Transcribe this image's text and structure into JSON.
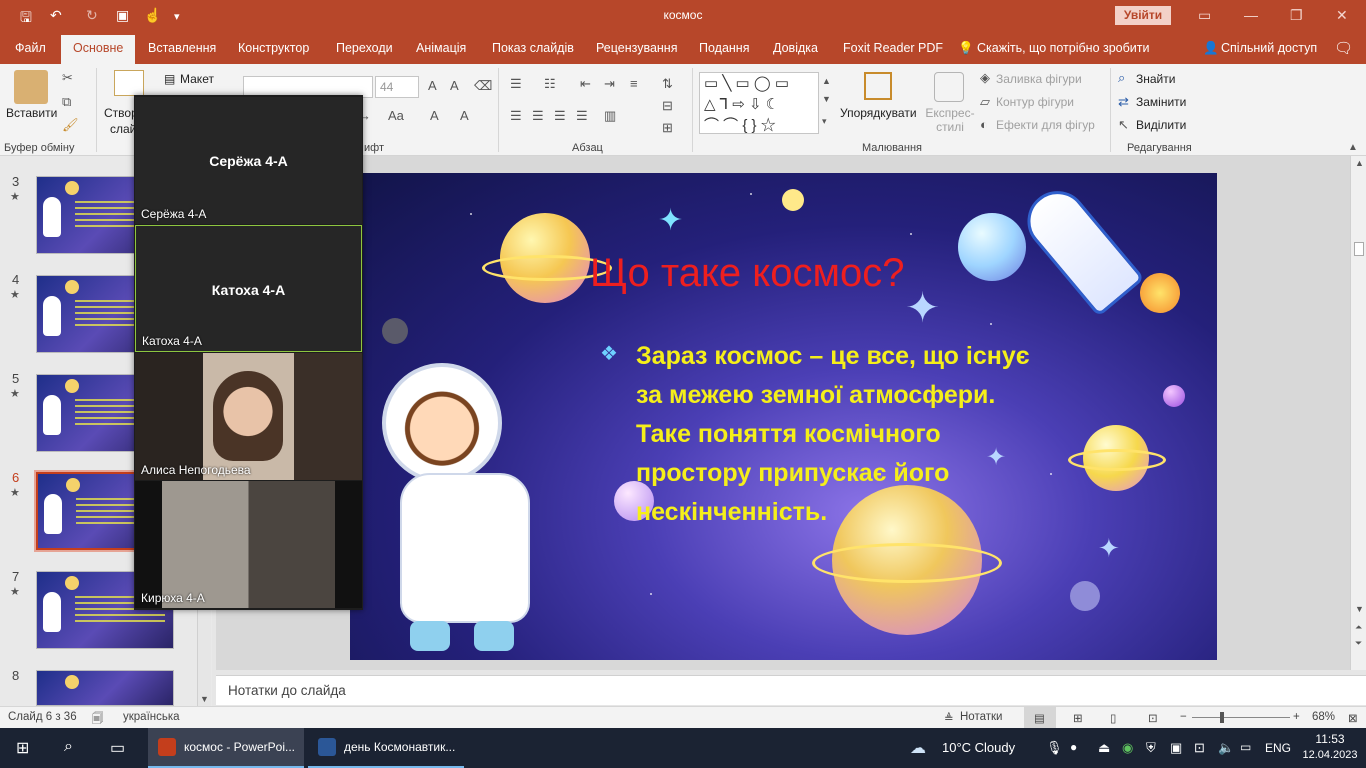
{
  "titlebar": {
    "title": "космос",
    "login_label": "Увійти",
    "save_icon": "save-icon",
    "undo_icon": "undo-icon",
    "redo_icon": "redo-icon"
  },
  "tabs": [
    {
      "label": "Файл"
    },
    {
      "label": "Основне"
    },
    {
      "label": "Вставлення"
    },
    {
      "label": "Конструктор"
    },
    {
      "label": "Переходи"
    },
    {
      "label": "Анімація"
    },
    {
      "label": "Показ слайдів"
    },
    {
      "label": "Рецензування"
    },
    {
      "label": "Подання"
    },
    {
      "label": "Довідка"
    },
    {
      "label": "Foxit Reader PDF"
    }
  ],
  "tell_me": "Скажіть, що потрібно зробити",
  "share": "Спільний доступ",
  "ribbon": {
    "paste": "Вставити",
    "clipboard_group": "Буфер обміну",
    "create_partial": "Створ",
    "slides_partial": "слай",
    "layout": "Макет",
    "font_group_partial": "ифт",
    "font_size": "44",
    "paragraph_group": "Абзац",
    "arrange": "Упорядкувати",
    "express_styles": "Експрес-стилі",
    "shape_fill": "Заливка фігури",
    "shape_outline": "Контур фігури",
    "shape_effects": "Ефекти для фігур",
    "drawing_group": "Малювання",
    "find": "Знайти",
    "replace": "Замінити",
    "select": "Виділити",
    "editing_group": "Редагування"
  },
  "thumbnails": [
    {
      "number": "3",
      "star": "★"
    },
    {
      "number": "4",
      "star": "★"
    },
    {
      "number": "5",
      "star": "★"
    },
    {
      "number": "6",
      "star": "★"
    },
    {
      "number": "7",
      "star": "★"
    },
    {
      "number": "8",
      "star": ""
    }
  ],
  "slide": {
    "title": "Що таке космос?",
    "bullet": "❖",
    "body": "Зараз космос – це все, що існує за межею земної атмосфери. Таке поняття космічного простору припускає його нескінченність."
  },
  "notes_placeholder": "Нотатки до слайда",
  "status": {
    "slide_counter": "Слайд 6 з 36",
    "language": "українська",
    "notes_button": "Нотатки",
    "zoom": "68%"
  },
  "zoom_panel": {
    "participants": [
      {
        "name_big": "Серёжа 4-А",
        "caption": "Серёжа 4-А"
      },
      {
        "name_big": "Катоха 4-А",
        "caption": "Катоха 4-А"
      },
      {
        "name_big": "",
        "caption": "Алиса Непогодьева"
      },
      {
        "name_big": "",
        "caption": "Кирюха 4-А"
      }
    ]
  },
  "taskbar": {
    "apps": [
      {
        "label": "космос - PowerPoi..."
      },
      {
        "label": "день Космонавтик..."
      }
    ],
    "weather": "10°C  Cloudy",
    "lang": "ENG",
    "time": "11:53",
    "date": "12.04.2023"
  }
}
